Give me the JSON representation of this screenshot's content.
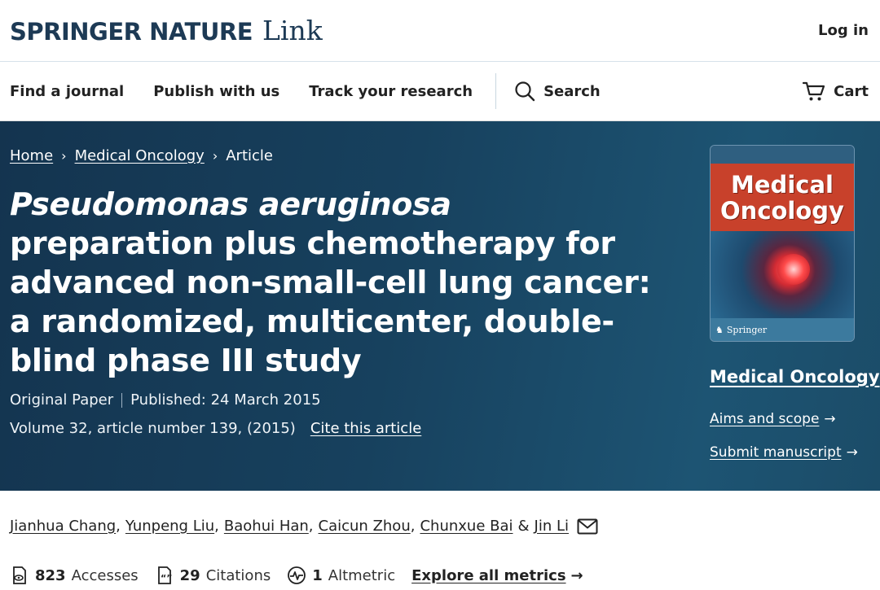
{
  "header": {
    "brand": "SPRINGER NATURE",
    "brand_sub": "Link",
    "login": "Log in"
  },
  "nav": {
    "items": [
      "Find a journal",
      "Publish with us",
      "Track your research"
    ],
    "search": "Search",
    "cart": "Cart"
  },
  "breadcrumb": [
    "Home",
    "Medical Oncology",
    "Article"
  ],
  "article": {
    "title_italic": "Pseudomonas aeruginosa",
    "title_rest": " preparation plus chemotherapy for advanced non-small-cell lung cancer: a randomized, multicenter, double-blind phase III study",
    "type": "Original Paper",
    "published": "Published: 24 March 2015",
    "volume": "Volume 32, article number 139, (2015)",
    "cite": "Cite this article"
  },
  "journal": {
    "cover_title_1": "Medical",
    "cover_title_2": "Oncology",
    "cover_publisher": "Springer",
    "name": "Medical Oncology",
    "aims": "Aims and scope",
    "submit": "Submit manuscript",
    "arrow": "→"
  },
  "authors": [
    "Jianhua Chang",
    "Yunpeng Liu",
    "Baohui Han",
    "Caicun Zhou",
    "Chunxue Bai",
    "Jin Li"
  ],
  "authors_sep": ",",
  "authors_amp": "&",
  "metrics": {
    "accesses_count": "823",
    "accesses_label": "Accesses",
    "citations_count": "29",
    "citations_label": "Citations",
    "altmetric_count": "1",
    "altmetric_label": "Altmetric",
    "explore": "Explore all metrics",
    "arrow": "→"
  },
  "colors": {
    "brand": "#1d3a55",
    "hero_dark": "#14344f",
    "hero_light": "#1d5473",
    "cover_red": "#c8412b"
  }
}
